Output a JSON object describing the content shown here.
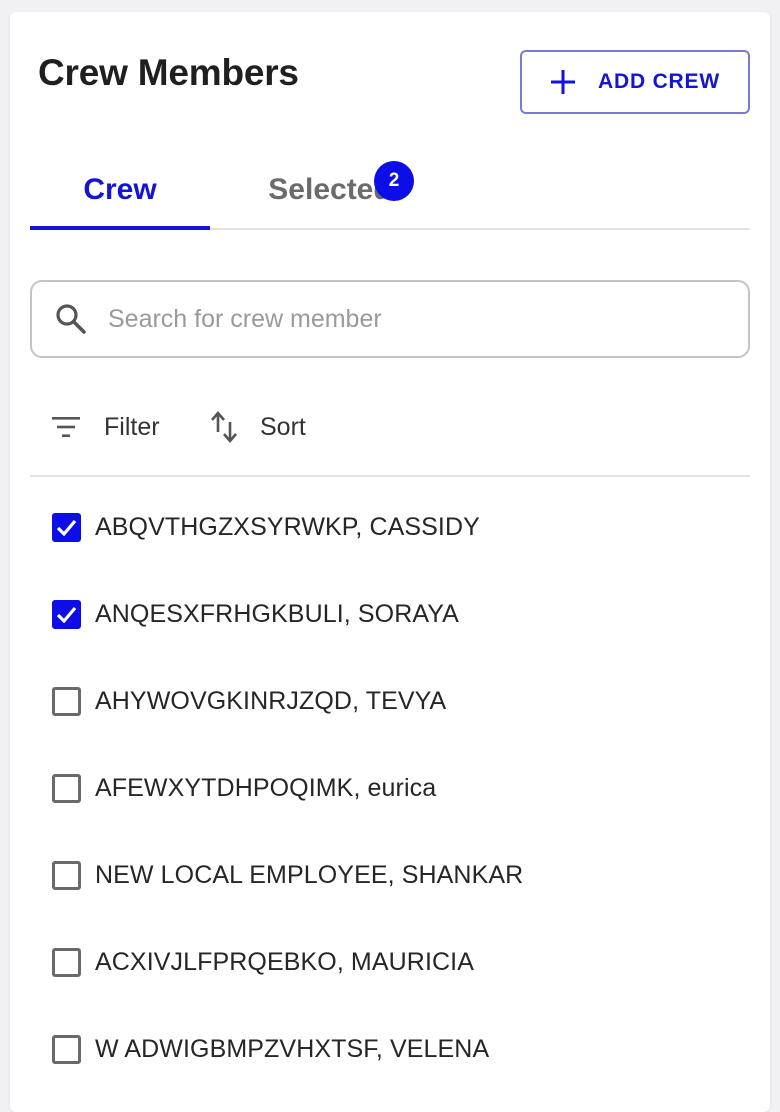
{
  "header": {
    "title": "Crew Members",
    "add_button_label": "ADD CREW"
  },
  "tabs": [
    {
      "label": "Crew",
      "active": true
    },
    {
      "label": "Selected",
      "badge": "2",
      "active": false
    }
  ],
  "search": {
    "placeholder": "Search for crew member",
    "value": ""
  },
  "toolbar": {
    "filter_label": "Filter",
    "sort_label": "Sort"
  },
  "crew_list": [
    {
      "name": "ABQVTHGZXSYRWKP, CASSIDY",
      "checked": true
    },
    {
      "name": "ANQESXFRHGKBULI, SORAYA",
      "checked": true
    },
    {
      "name": "AHYWOVGKINRJZQD, TEVYA",
      "checked": false
    },
    {
      "name": "AFEWXYTDHPOQIMK, eurica",
      "checked": false
    },
    {
      "name": "NEW LOCAL EMPLOYEE, SHANKAR",
      "checked": false
    },
    {
      "name": "ACXIVJLFPRQEBKO, MAURICIA",
      "checked": false
    },
    {
      "name": "W ADWIGBMPZVHXTSF, VELENA",
      "checked": false
    }
  ],
  "colors": {
    "accent": "#1414d6",
    "badge": "#0d0de8",
    "text": "#262626",
    "muted": "#6b6b6b"
  }
}
